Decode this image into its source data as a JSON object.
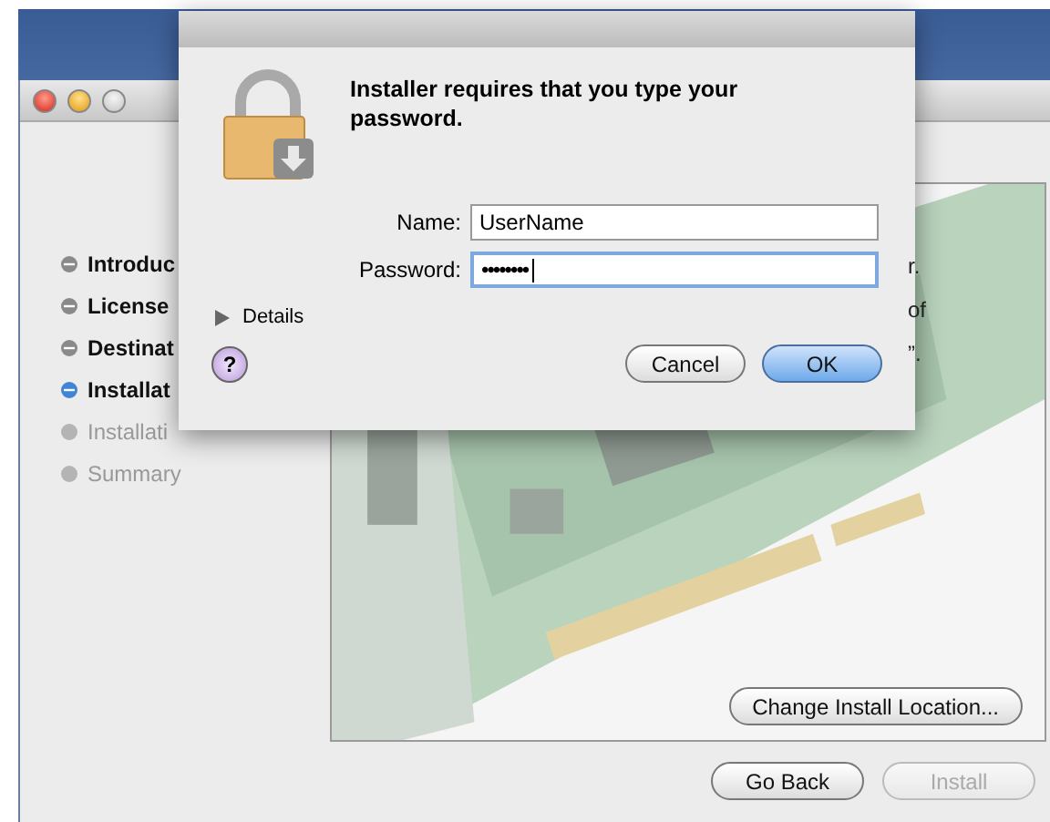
{
  "installer": {
    "steps": [
      {
        "label": "Introduc",
        "current": false,
        "disabled": false
      },
      {
        "label": "License",
        "current": false,
        "disabled": false
      },
      {
        "label": "Destinat",
        "current": false,
        "disabled": false
      },
      {
        "label": "Installat",
        "current": true,
        "disabled": false
      },
      {
        "label": "Installati",
        "current": false,
        "disabled": true
      },
      {
        "label": "Summary",
        "current": false,
        "disabled": true
      }
    ],
    "text_fragments": [
      "r.",
      "of",
      "”."
    ],
    "change_location_button": "Change Install Location...",
    "buttons": [
      {
        "label": "Go Back",
        "disabled": false
      },
      {
        "label": "Install",
        "disabled": true
      }
    ]
  },
  "dialog": {
    "message": "Installer requires that you type your password.",
    "fields": [
      {
        "label": "Name:",
        "value": "UserName",
        "kind": "text",
        "focused": false
      },
      {
        "label": "Password:",
        "value": "••••••••",
        "kind": "password",
        "focused": true
      }
    ],
    "details": {
      "label": "Details",
      "expanded": false
    },
    "help": "?",
    "buttons": [
      {
        "label": "Cancel",
        "default": false
      },
      {
        "label": "OK",
        "default": true
      }
    ]
  }
}
